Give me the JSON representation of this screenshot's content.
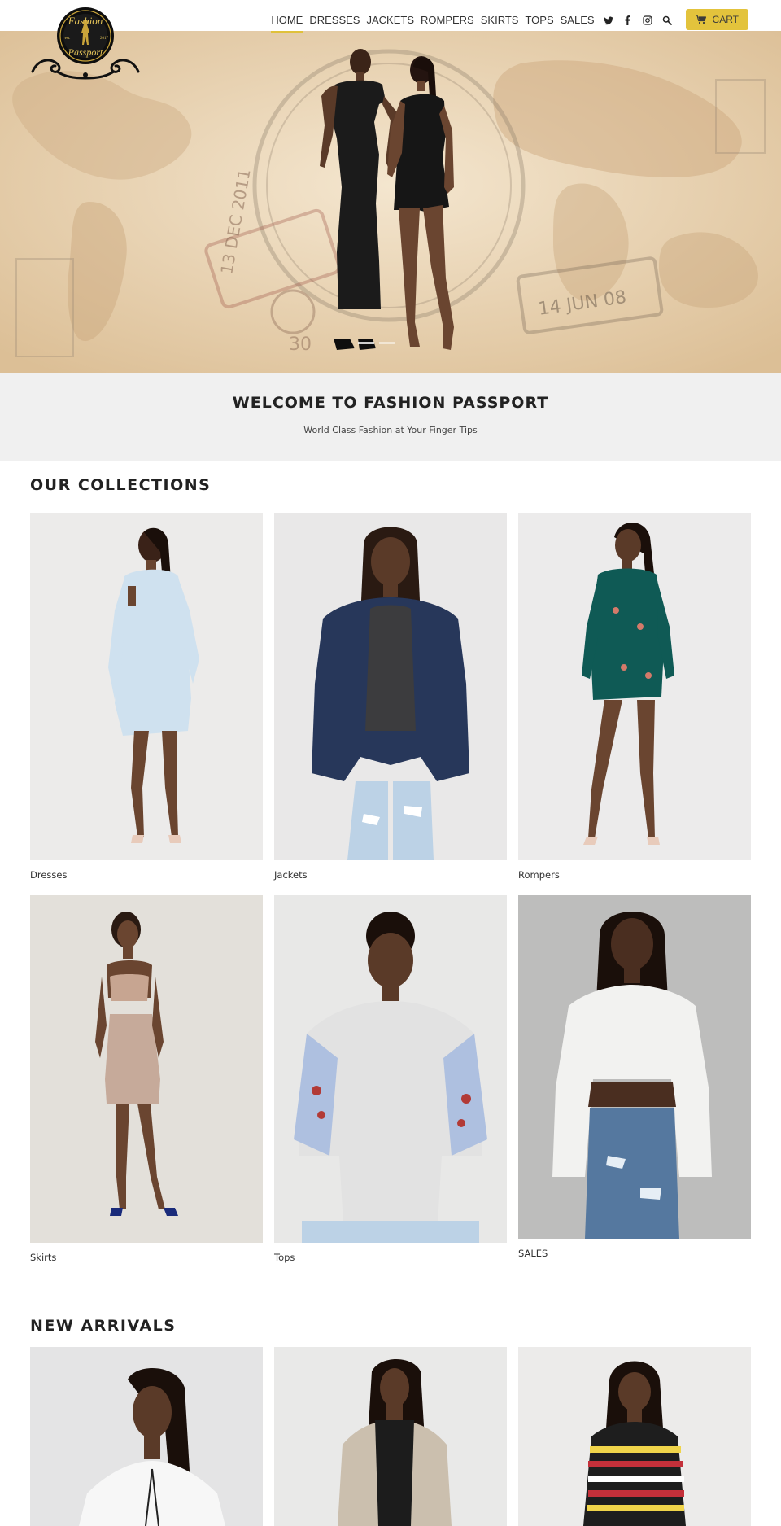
{
  "brand": {
    "logo_text_top": "Fashion",
    "logo_text_bottom": "Passport",
    "logo_est": "est.",
    "logo_year": "2017"
  },
  "nav": {
    "items": [
      {
        "label": "HOME",
        "active": true
      },
      {
        "label": "DRESSES",
        "active": false
      },
      {
        "label": "JACKETS",
        "active": false
      },
      {
        "label": "ROMPERS",
        "active": false
      },
      {
        "label": "SKIRTS",
        "active": false
      },
      {
        "label": "TOPS",
        "active": false
      },
      {
        "label": "SALES",
        "active": false
      }
    ],
    "icons": [
      "twitter-icon",
      "facebook-icon",
      "instagram-icon",
      "search-icon"
    ],
    "cart_label": "CART"
  },
  "hero": {
    "stamp_dates": [
      "13 DEC 2011",
      "14 JUN 08",
      "30"
    ]
  },
  "welcome": {
    "title": "WELCOME TO FASHION PASSPORT",
    "subtitle": "World Class Fashion at Your Finger Tips"
  },
  "collections": {
    "title": "OUR COLLECTIONS",
    "items": [
      {
        "label": "Dresses"
      },
      {
        "label": "Jackets"
      },
      {
        "label": "Rompers"
      },
      {
        "label": "Skirts"
      },
      {
        "label": "Tops"
      },
      {
        "label": "SALES"
      }
    ]
  },
  "new_arrivals": {
    "title": "NEW ARRIVALS"
  },
  "colors": {
    "accent": "#e3c33c",
    "welcome_bg": "#f0f0f0",
    "text": "#222222"
  }
}
